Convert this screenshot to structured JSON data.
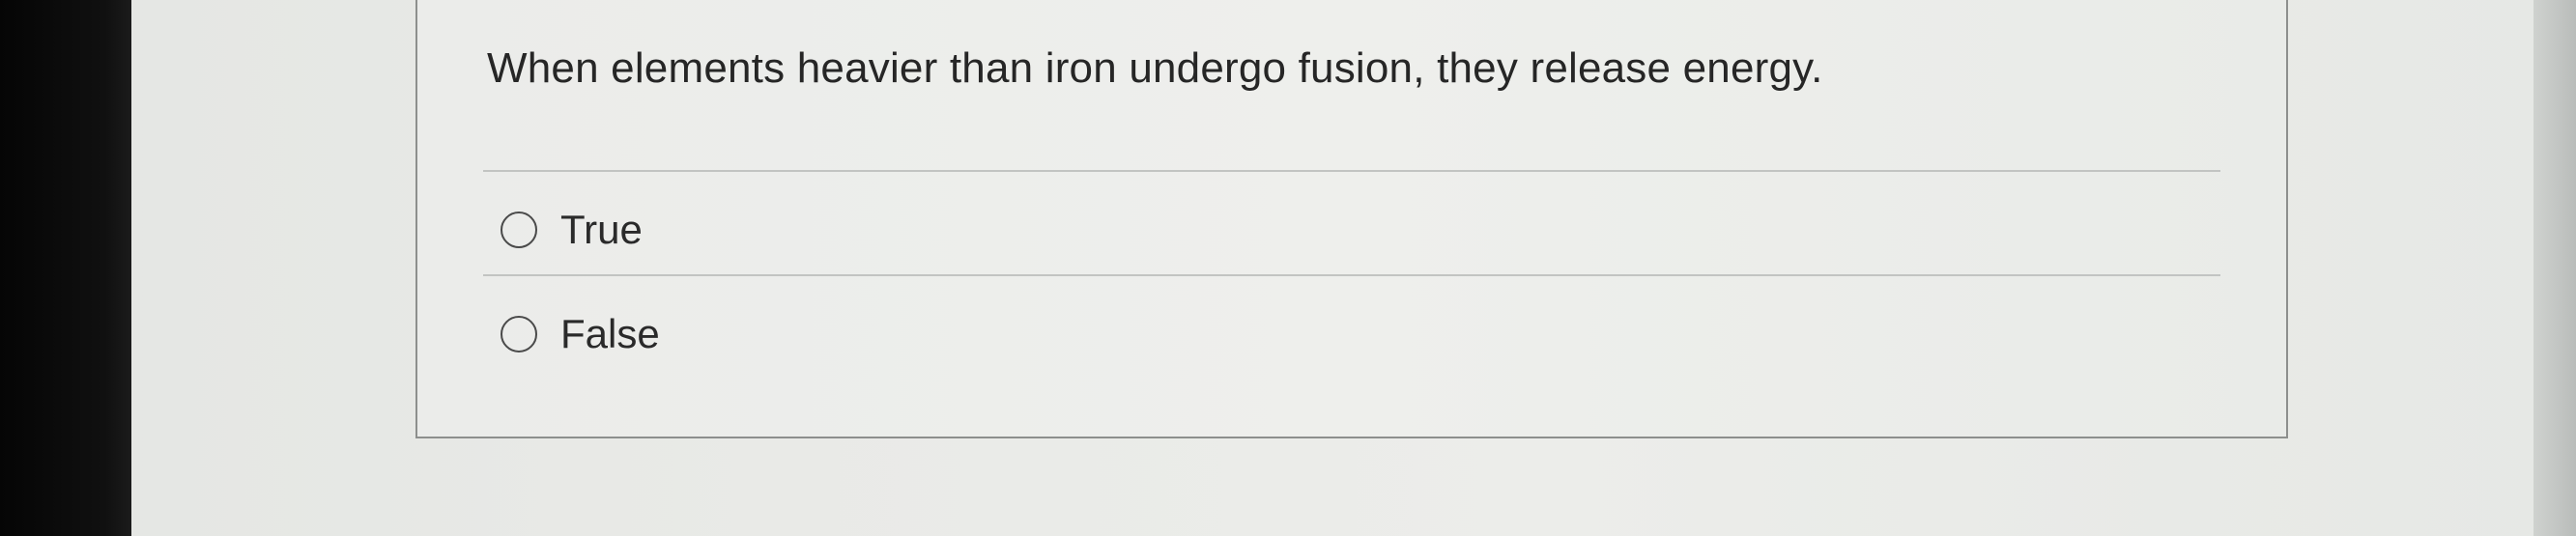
{
  "question": {
    "text": "When elements heavier than iron undergo fusion, they release energy."
  },
  "options": [
    {
      "label": "True",
      "selected": false
    },
    {
      "label": "False",
      "selected": false
    }
  ],
  "colors": {
    "text": "#262626",
    "border": "#8d8f8d",
    "divider": "#c2c4c2"
  }
}
